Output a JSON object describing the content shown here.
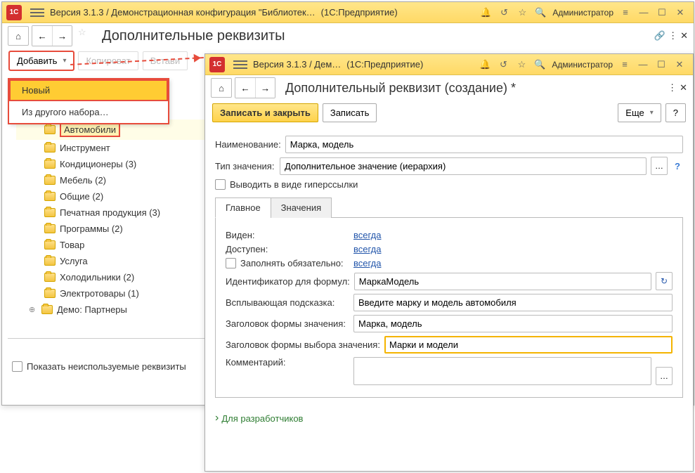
{
  "window1": {
    "titlebar": {
      "title": "Версия 3.1.3 / Демонстрационная конфигурация \"Библиотек…",
      "subtitle": "(1С:Предприятие)",
      "user": "Администратор"
    },
    "page_title": "Дополнительные реквизиты",
    "toolbar": {
      "add": "Добавить",
      "copy": "Копироват",
      "paste": "Встави"
    },
    "menu": {
      "new": "Новый",
      "from_other": "Из другого набора…"
    },
    "tree": [
      "Автомобили",
      "Инструмент",
      "Кондиционеры (3)",
      "Мебель (2)",
      "Общие (2)",
      "Печатная продукция (3)",
      "Программы (2)",
      "Товар",
      "Услуга",
      "Холодильники (2)",
      "Электротовары (1)"
    ],
    "tree_group": "Демо: Партнеры",
    "show_unused": "Показать неиспользуемые реквизиты"
  },
  "window2": {
    "titlebar": {
      "title": "Версия 3.1.3 / Дем…",
      "subtitle": "(1С:Предприятие)",
      "user": "Администратор"
    },
    "page_title": "Дополнительный реквизит (создание) *",
    "buttons": {
      "save_close": "Записать и закрыть",
      "save": "Записать",
      "more": "Еще",
      "help": "?"
    },
    "fields": {
      "name_label": "Наименование:",
      "name_value": "Марка, модель",
      "type_label": "Тип значения:",
      "type_value": "Дополнительное значение (иерархия)",
      "hyperlink_label": "Выводить в виде гиперссылки",
      "visible_label": "Виден:",
      "visible_link": "всегда",
      "available_label": "Доступен:",
      "available_link": "всегда",
      "required_label": "Заполнять обязательно:",
      "required_link": "всегда",
      "id_label": "Идентификатор для формул:",
      "id_value": "МаркаМодель",
      "tooltip_label": "Всплывающая подсказка:",
      "tooltip_value": "Введите марку и модель автомобиля",
      "value_form_title_label": "Заголовок формы значения:",
      "value_form_title_value": "Марка, модель",
      "choice_form_title_label": "Заголовок формы выбора значения:",
      "choice_form_title_value": "Марки и модели",
      "comment_label": "Комментарий:"
    },
    "tabs": {
      "main": "Главное",
      "values": "Значения"
    },
    "dev_link": "Для разработчиков"
  }
}
